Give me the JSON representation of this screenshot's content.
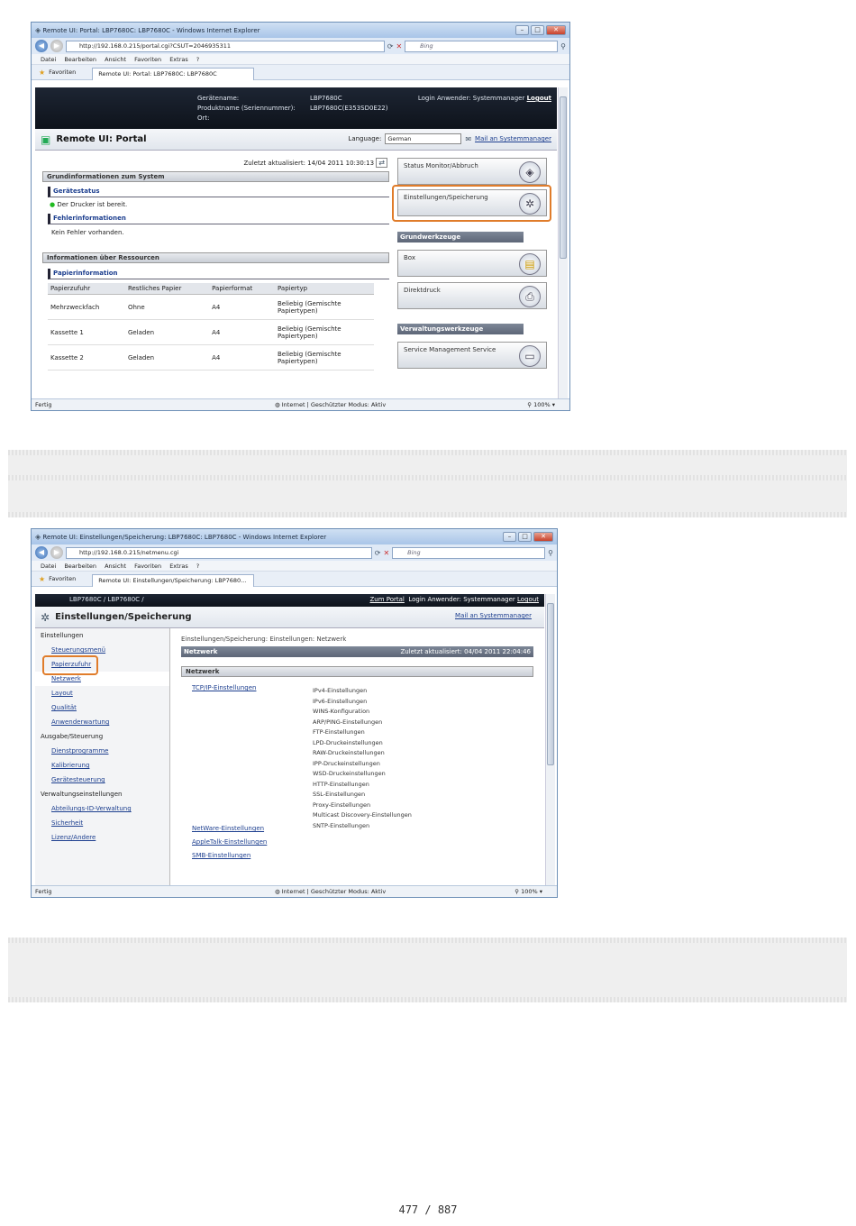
{
  "win1": {
    "title": "Remote UI: Portal: LBP7680C: LBP7680C - Windows Internet Explorer",
    "url": "http://192.168.0.215/portal.cgi?CSUT=2046935311",
    "search": "Bing",
    "menus": [
      "Datei",
      "Bearbeiten",
      "Ansicht",
      "Favoriten",
      "Extras",
      "?"
    ],
    "favorites": "Favoriten",
    "tab": "Remote UI: Portal: LBP7680C: LBP7680C",
    "hdr": {
      "l1": "Gerätename:",
      "v1": "LBP7680C",
      "l2": "Produktname (Seriennummer):",
      "v2": "LBP7680C(E353SD0E22)",
      "l3": "Ort:",
      "login_label": "Login Anwender: Systemmanager",
      "logout": "Logout"
    },
    "portal_title": "Remote UI: Portal",
    "language_label": "Language:",
    "language_value": "German",
    "mail": "Mail an Systemmanager",
    "updated": "Zuletzt aktualisiert: 14/04 2011 10:30:13",
    "sec_basic": "Grundinformationen zum System",
    "device_status_h": "Gerätestatus",
    "device_status": "Der Drucker ist bereit.",
    "error_h": "Fehlerinformationen",
    "error": "Kein Fehler vorhanden.",
    "sec_res": "Informationen über Ressourcen",
    "paper_h": "Papierinformation",
    "cols": [
      "Papierzufuhr",
      "Restliches Papier",
      "Papierformat",
      "Papiertyp"
    ],
    "rows": [
      [
        "Mehrzweckfach",
        "Ohne",
        "A4",
        "Beliebig (Gemischte Papiertypen)"
      ],
      [
        "Kassette 1",
        "Geladen",
        "A4",
        "Beliebig (Gemischte Papiertypen)"
      ],
      [
        "Kassette 2",
        "Geladen",
        "A4",
        "Beliebig (Gemischte Papiertypen)"
      ]
    ],
    "btn_status": "Status Monitor/Abbruch",
    "btn_settings": "Einstellungen/Speicherung",
    "grp_basic": "Grundwerkzeuge",
    "btn_box": "Box",
    "btn_direct": "Direktdruck",
    "grp_admin": "Verwaltungswerkzeuge",
    "btn_service": "Service Management Service",
    "status_left": "Fertig",
    "status_mid": "Internet | Geschützter Modus: Aktiv",
    "zoom": "100%"
  },
  "win2": {
    "title": "Remote UI: Einstellungen/Speicherung: LBP7680C: LBP7680C - Windows Internet Explorer",
    "url": "http://192.168.0.215/netmenu.cgi",
    "search": "Bing",
    "menus": [
      "Datei",
      "Bearbeiten",
      "Ansicht",
      "Favoriten",
      "Extras",
      "?"
    ],
    "favorites": "Favoriten",
    "tab": "Remote UI: Einstellungen/Speicherung: LBP7680...",
    "model": "LBP7680C / LBP7680C /",
    "to_portal": "Zum Portal",
    "login_label": "Login Anwender: Systemmanager",
    "logout": "Logout",
    "page_title": "Einstellungen/Speicherung",
    "mail": "Mail an Systemmanager",
    "side": [
      {
        "t": "h",
        "label": "Einstellungen"
      },
      {
        "t": "i",
        "label": "Steuerungsmenü"
      },
      {
        "t": "i",
        "label": "Papierzufuhr"
      },
      {
        "t": "i",
        "label": "Netzwerk",
        "sel": true
      },
      {
        "t": "i",
        "label": "Layout"
      },
      {
        "t": "i",
        "label": "Qualität"
      },
      {
        "t": "i",
        "label": "Anwenderwartung"
      },
      {
        "t": "h",
        "label": "Ausgabe/Steuerung"
      },
      {
        "t": "i",
        "label": "Dienstprogramme"
      },
      {
        "t": "i",
        "label": "Kalibrierung"
      },
      {
        "t": "i",
        "label": "Gerätesteuerung"
      },
      {
        "t": "h",
        "label": "Verwaltungseinstellungen"
      },
      {
        "t": "i",
        "label": "Abteilungs-ID-Verwaltung"
      },
      {
        "t": "i",
        "label": "Sicherheit"
      },
      {
        "t": "i",
        "label": "Lizenz/Andere"
      }
    ],
    "breadcrumb": "Einstellungen/Speicherung: Einstellungen: Netzwerk",
    "bar1": "Netzwerk",
    "bar1_right": "Zuletzt aktualisiert: 04/04 2011 22:04:46",
    "bar2": "Netzwerk",
    "tcp": "TCP/IP-Einstellungen",
    "tcp_items": [
      "IPv4-Einstellungen",
      "IPv6-Einstellungen",
      "WINS-Konfiguration",
      "ARP/PING-Einstellungen",
      "FTP-Einstellungen",
      "LPD-Druckeinstellungen",
      "RAW-Druckeinstellungen",
      "IPP-Druckeinstellungen",
      "WSD-Druckeinstellungen",
      "HTTP-Einstellungen",
      "SSL-Einstellungen",
      "Proxy-Einstellungen",
      "Multicast Discovery-Einstellungen",
      "SNTP-Einstellungen"
    ],
    "links": [
      "NetWare-Einstellungen",
      "AppleTalk-Einstellungen",
      "SMB-Einstellungen"
    ],
    "status_left": "Fertig",
    "status_mid": "Internet | Geschützter Modus: Aktiv",
    "zoom": "100%"
  },
  "page": "477 / 887"
}
